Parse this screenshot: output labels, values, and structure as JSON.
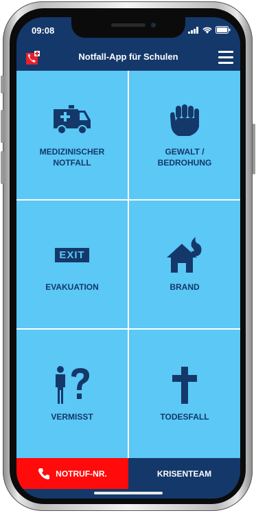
{
  "status": {
    "time": "09:08"
  },
  "header": {
    "title": "Notfall-App für Schulen"
  },
  "tiles": [
    {
      "label": "MEDIZINISCHER\nNOTFALL",
      "icon": "ambulance-icon"
    },
    {
      "label": "GEWALT /\nBEDROHUNG",
      "icon": "fist-icon"
    },
    {
      "label": "",
      "icon": "exit-sign-icon",
      "icon_text": "EXIT"
    },
    {
      "label": "BRAND",
      "icon": "house-fire-icon"
    },
    {
      "label": "",
      "icon": "person-question-icon"
    },
    {
      "label": "TODESFALL",
      "icon": "cross-icon"
    }
  ],
  "tile_labels": {
    "evakuation": "EVAKUATION",
    "vermisst": "VERMISST"
  },
  "bottom": {
    "notruf_label": "NOTRUF-NR.",
    "krisenteam_label": "KRISENTEAM"
  },
  "colors": {
    "navy": "#14386a",
    "tile": "#5bc8f5",
    "emergency_red": "#ff0b0b"
  }
}
